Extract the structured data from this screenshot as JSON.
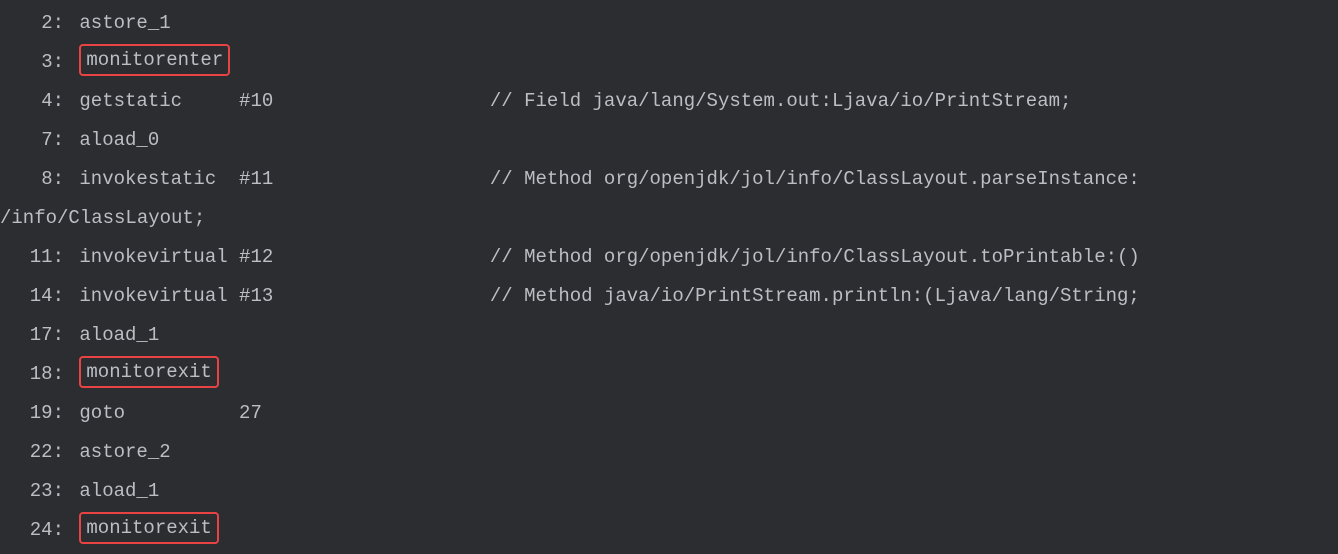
{
  "lines": [
    {
      "offset": "2:",
      "opcode": "astore_1",
      "operand": "",
      "comment": "",
      "highlighted": false
    },
    {
      "offset": "3:",
      "opcode": "monitorenter",
      "operand": "",
      "comment": "",
      "highlighted": true
    },
    {
      "offset": "4:",
      "opcode": "getstatic",
      "operand": "#10",
      "comment": "// Field java/lang/System.out:Ljava/io/PrintStream;",
      "highlighted": false
    },
    {
      "offset": "7:",
      "opcode": "aload_0",
      "operand": "",
      "comment": "",
      "highlighted": false
    },
    {
      "offset": "8:",
      "opcode": "invokestatic",
      "operand": "#11",
      "comment": "// Method org/openjdk/jol/info/ClassLayout.parseInstance:",
      "highlighted": false
    },
    {
      "wrapped": true,
      "text": "/info/ClassLayout;"
    },
    {
      "offset": "11:",
      "opcode": "invokevirtual",
      "operand": "#12",
      "comment": "// Method org/openjdk/jol/info/ClassLayout.toPrintable:()",
      "highlighted": false
    },
    {
      "offset": "14:",
      "opcode": "invokevirtual",
      "operand": "#13",
      "comment": "// Method java/io/PrintStream.println:(Ljava/lang/String;",
      "highlighted": false
    },
    {
      "offset": "17:",
      "opcode": "aload_1",
      "operand": "",
      "comment": "",
      "highlighted": false
    },
    {
      "offset": "18:",
      "opcode": "monitorexit",
      "operand": "",
      "comment": "",
      "highlighted": true
    },
    {
      "offset": "19:",
      "opcode": "goto",
      "operand": "27",
      "comment": "",
      "highlighted": false,
      "goto": true
    },
    {
      "offset": "22:",
      "opcode": "astore_2",
      "operand": "",
      "comment": "",
      "highlighted": false
    },
    {
      "offset": "23:",
      "opcode": "aload_1",
      "operand": "",
      "comment": "",
      "highlighted": false
    },
    {
      "offset": "24:",
      "opcode": "monitorexit",
      "operand": "",
      "comment": "",
      "highlighted": true
    }
  ]
}
